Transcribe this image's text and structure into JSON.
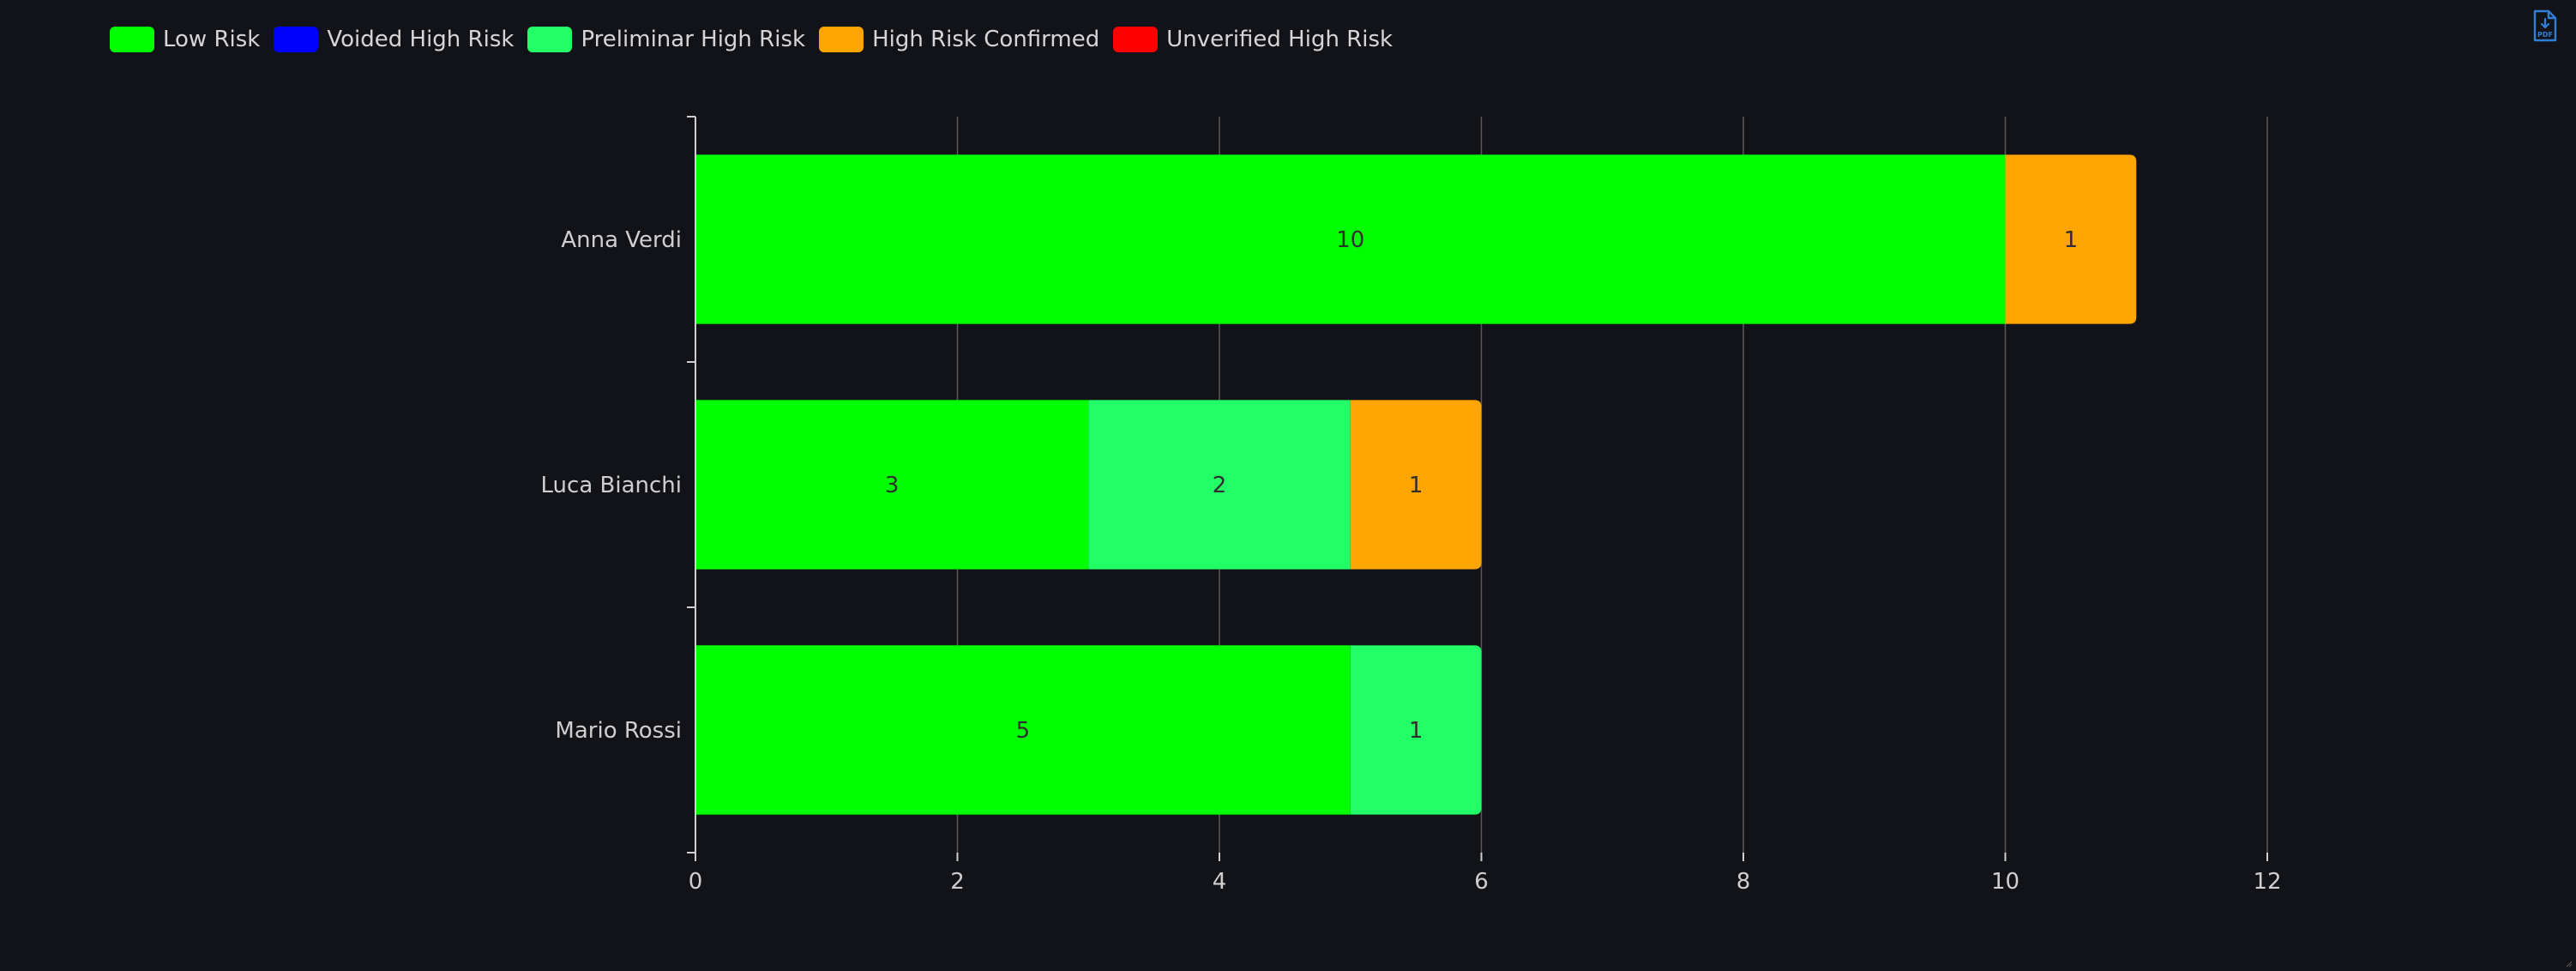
{
  "legend": [
    {
      "label": "Low Risk",
      "color": "#00ff00"
    },
    {
      "label": "Voided High Risk",
      "color": "#0000ff"
    },
    {
      "label": "Preliminar High Risk",
      "color": "#22ff66"
    },
    {
      "label": "High Risk Confirmed",
      "color": "#ffa500"
    },
    {
      "label": "Unverified High Risk",
      "color": "#ff0000"
    }
  ],
  "toolbar": {
    "export_icon": "pdf-export-icon"
  },
  "chart_data": {
    "type": "bar",
    "orientation": "horizontal",
    "stacked": true,
    "categories": [
      "Anna Verdi",
      "Luca Bianchi",
      "Mario Rossi"
    ],
    "series": [
      {
        "name": "Low Risk",
        "color": "#00ff00",
        "values": [
          10,
          3,
          5
        ]
      },
      {
        "name": "Voided High Risk",
        "color": "#0000ff",
        "values": [
          0,
          0,
          0
        ]
      },
      {
        "name": "Preliminar High Risk",
        "color": "#22ff66",
        "values": [
          0,
          2,
          1
        ]
      },
      {
        "name": "High Risk Confirmed",
        "color": "#ffa500",
        "values": [
          1,
          1,
          0
        ]
      },
      {
        "name": "Unverified High Risk",
        "color": "#ff0000",
        "values": [
          0,
          0,
          0
        ]
      }
    ],
    "xlim": [
      0,
      12
    ],
    "xticks": [
      0,
      2,
      4,
      6,
      8,
      10,
      12
    ],
    "grid": true,
    "legend_position": "top-left",
    "background": "#121318",
    "grid_color": "#5a5a5a",
    "axis_color": "#cfcfcf"
  }
}
